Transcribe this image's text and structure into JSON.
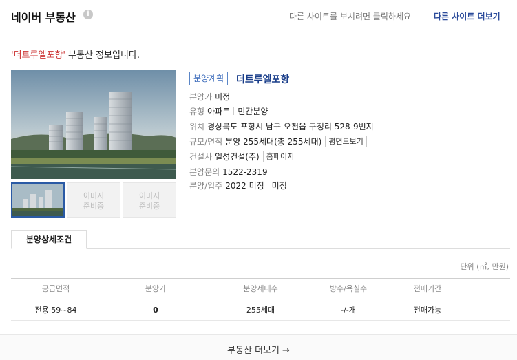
{
  "header": {
    "title": "네이버 부동산",
    "info_icon": "i",
    "hint": "다른 사이트를 보시려면 클릭하세요",
    "more_link": "다른 사이트 더보기"
  },
  "intro": {
    "quoted_name": "'더트루엘포항'",
    "suffix": " 부동산 정보입니다."
  },
  "gallery": {
    "thumbnails": [
      {
        "placeholder": ""
      },
      {
        "placeholder": "이미지\n준비중"
      },
      {
        "placeholder": "이미지\n준비중"
      }
    ],
    "placeholder_line1": "이미지",
    "placeholder_line2": "준비중"
  },
  "property": {
    "badge": "분양계획",
    "name": "더트루엘포항",
    "price": {
      "label": "분양가",
      "value": "미정"
    },
    "type": {
      "label": "유형",
      "value1": "아파트",
      "value2": "민간분양"
    },
    "location": {
      "label": "위치",
      "value": "경상북도 포항시 남구 오천읍 구정리 528-9번지"
    },
    "scale": {
      "label": "규모/면적",
      "value": "분양 255세대(총 255세대)",
      "button": "평면도보기"
    },
    "builder": {
      "label": "건설사",
      "value": "일성건설(주)",
      "button": "홈페이지"
    },
    "inquiry": {
      "label": "분양문의",
      "value": "1522-2319"
    },
    "move_in": {
      "label": "분양/입주",
      "value1": "2022 미정",
      "value2": "미정"
    }
  },
  "tab": {
    "label": "분양상세조건"
  },
  "table": {
    "unit": "단위 (㎡, 만원)",
    "headers": [
      "공급면적",
      "분양가",
      "분양세대수",
      "방수/욕실수",
      "전매기간"
    ],
    "rows": [
      [
        "전용 59~84",
        "0",
        "255세대",
        "-/-개",
        "전매가능"
      ]
    ]
  },
  "footer": {
    "more": "부동산 더보기 →"
  },
  "colors": {
    "accent": "#1a3e8a",
    "badge": "#3b6bbb",
    "quote": "#cc3333"
  }
}
